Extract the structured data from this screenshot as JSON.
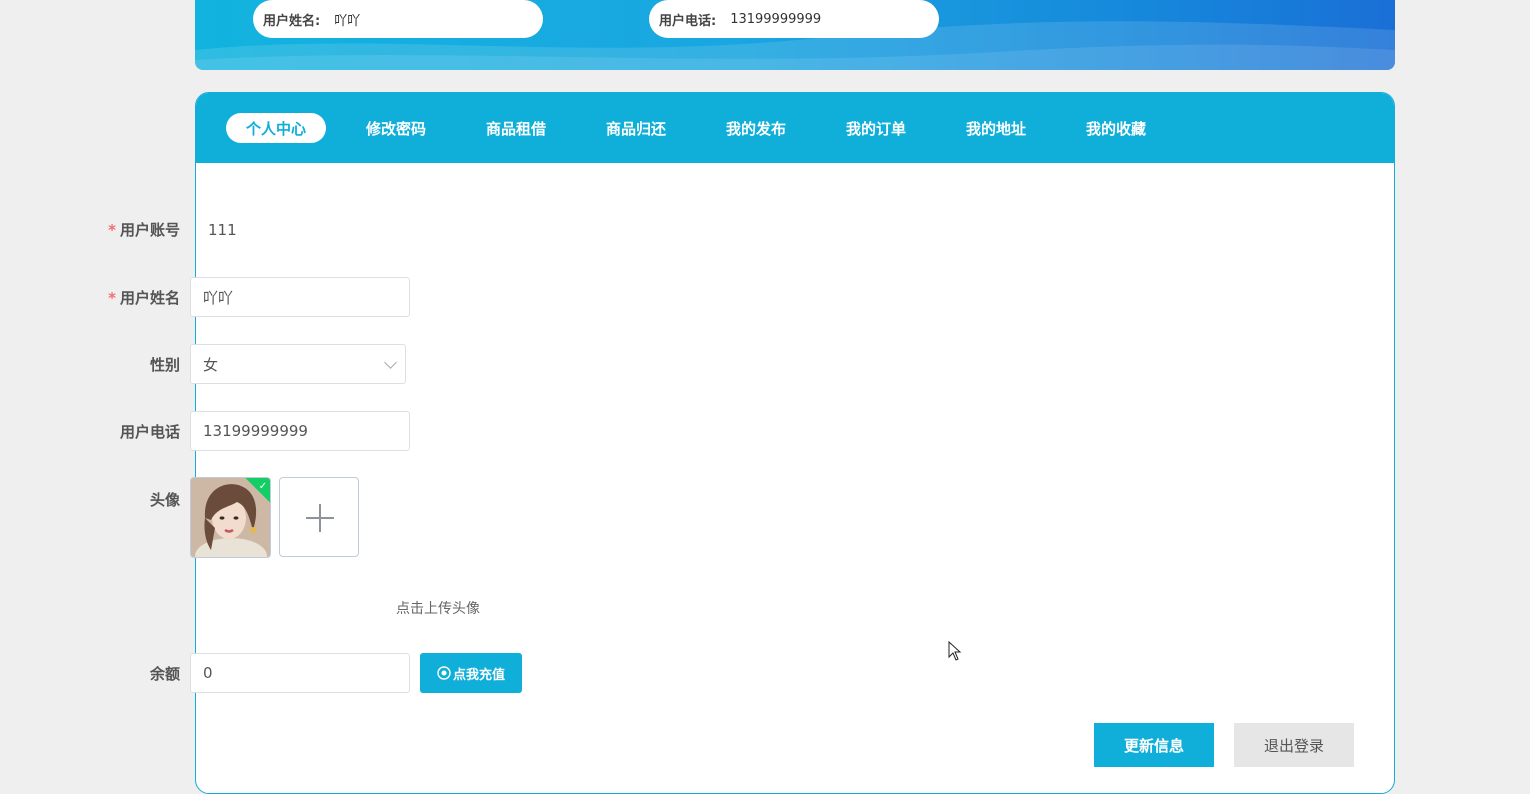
{
  "header": {
    "name_label": "用户姓名:",
    "name_value": "吖吖",
    "phone_label": "用户电话:",
    "phone_value": "13199999999"
  },
  "tabs": [
    {
      "label": "个人中心",
      "active": true
    },
    {
      "label": "修改密码"
    },
    {
      "label": "商品租借"
    },
    {
      "label": "商品归还"
    },
    {
      "label": "我的发布"
    },
    {
      "label": "我的订单"
    },
    {
      "label": "我的地址"
    },
    {
      "label": "我的收藏"
    }
  ],
  "form": {
    "required_mark": "*",
    "account_label": "用户账号",
    "account_value": "111",
    "name_label": "用户姓名",
    "name_value": "吖吖",
    "gender_label": "性别",
    "gender_value": "女",
    "phone_label": "用户电话",
    "phone_value": "13199999999",
    "avatar_label": "头像",
    "avatar_hint": "点击上传头像",
    "balance_label": "余额",
    "balance_value": "0",
    "recharge_label": "点我充值"
  },
  "actions": {
    "update": "更新信息",
    "logout": "退出登录"
  },
  "colors": {
    "primary": "#10afd9",
    "required": "#f56c6c",
    "success_badge": "#13ce66"
  }
}
